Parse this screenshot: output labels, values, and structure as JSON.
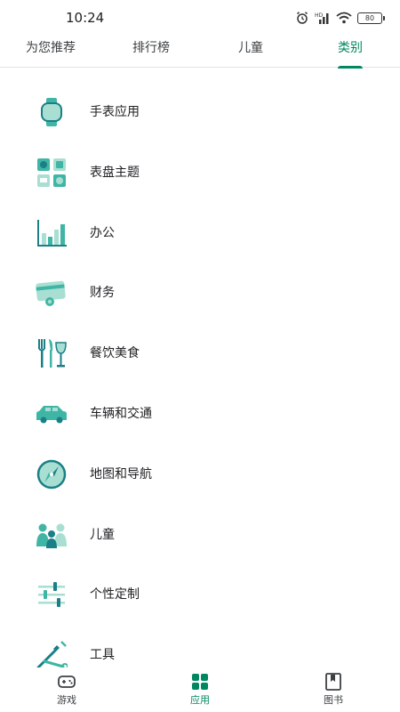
{
  "status_bar": {
    "time": "10:24",
    "battery": "80"
  },
  "top_tabs": [
    {
      "label": "为您推荐",
      "active": false
    },
    {
      "label": "排行榜",
      "active": false
    },
    {
      "label": "儿童",
      "active": false
    },
    {
      "label": "类别",
      "active": true
    }
  ],
  "categories": [
    {
      "label": "手表应用",
      "icon": "watch-icon"
    },
    {
      "label": "表盘主题",
      "icon": "watch-face-icon"
    },
    {
      "label": "办公",
      "icon": "chart-icon"
    },
    {
      "label": "财务",
      "icon": "finance-card-icon"
    },
    {
      "label": "餐饮美食",
      "icon": "cutlery-wine-icon"
    },
    {
      "label": "车辆和交通",
      "icon": "car-icon"
    },
    {
      "label": "地图和导航",
      "icon": "compass-icon"
    },
    {
      "label": "儿童",
      "icon": "family-icon"
    },
    {
      "label": "个性定制",
      "icon": "sliders-icon"
    },
    {
      "label": "工具",
      "icon": "tools-icon"
    }
  ],
  "bottom_nav": [
    {
      "label": "游戏",
      "icon": "gamepad-icon",
      "active": false
    },
    {
      "label": "应用",
      "icon": "apps-grid-icon",
      "active": true
    },
    {
      "label": "图书",
      "icon": "book-icon",
      "active": false
    }
  ],
  "colors": {
    "accent": "#01875f",
    "icon_teal": "#3fb6a5",
    "icon_light": "#a8dfd2",
    "icon_dark": "#1a7f86"
  }
}
